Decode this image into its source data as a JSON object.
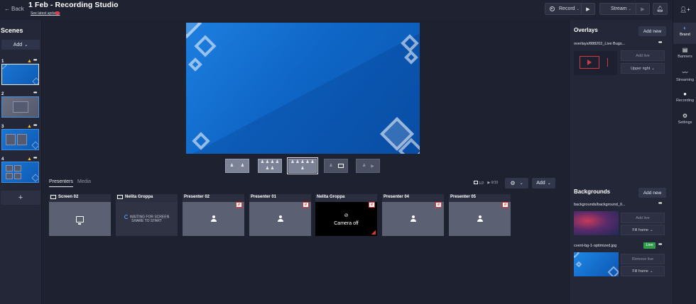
{
  "header": {
    "back_label": "Back",
    "title": "1 Feb - Recording Studio",
    "update_link": "See latest updates",
    "record_label": "Record",
    "stream_label": "Stream"
  },
  "scenes": {
    "title": "Scenes",
    "add_label": "Add",
    "items": [
      {
        "num": "1"
      },
      {
        "num": "2"
      },
      {
        "num": "3"
      },
      {
        "num": "4"
      }
    ],
    "plus_label": "+"
  },
  "presenters_bar": {
    "tab_presenters": "Presenters",
    "tab_media": "Media",
    "screens_count": "1/2",
    "media_count": "0/10",
    "add_label": "Add"
  },
  "cards": [
    {
      "label": "Screen 02",
      "type": "screen"
    },
    {
      "label": "Nelita Groppa",
      "type": "waiting",
      "waiting_text_1": "WAITING FOR SCREEN",
      "waiting_text_2": "SHARE TO START"
    },
    {
      "label": "Presenter 02",
      "type": "person"
    },
    {
      "label": "Presenter 01",
      "type": "person"
    },
    {
      "label": "Nelita Groppa",
      "type": "camera_off",
      "camera_text": "Camera off"
    },
    {
      "label": "Presenter 04",
      "type": "person"
    },
    {
      "label": "Presenter 05",
      "type": "person"
    }
  ],
  "overlays": {
    "title": "Overlays",
    "add_label": "Add new",
    "item_name": "overlays/888202_Live Bugs...",
    "add_live": "Add live",
    "position": "Upper right"
  },
  "backgrounds": {
    "title": "Backgrounds",
    "add_label": "Add new",
    "items": [
      {
        "name": "backgrounds/background_0...",
        "action": "Add live",
        "fit": "Fill frame"
      },
      {
        "name": "cvent-bg-1-optimized.jpg",
        "action": "Remove live",
        "fit": "Fill frame",
        "badge": "Live"
      }
    ]
  },
  "rail": {
    "items": [
      "Brand",
      "Banners",
      "Streaming",
      "Recording",
      "Settings"
    ]
  },
  "colors": {
    "accent": "#4aa3ff",
    "live": "#2f9e4b",
    "warning": "#f3c22f",
    "muted_red": "#e23434"
  }
}
